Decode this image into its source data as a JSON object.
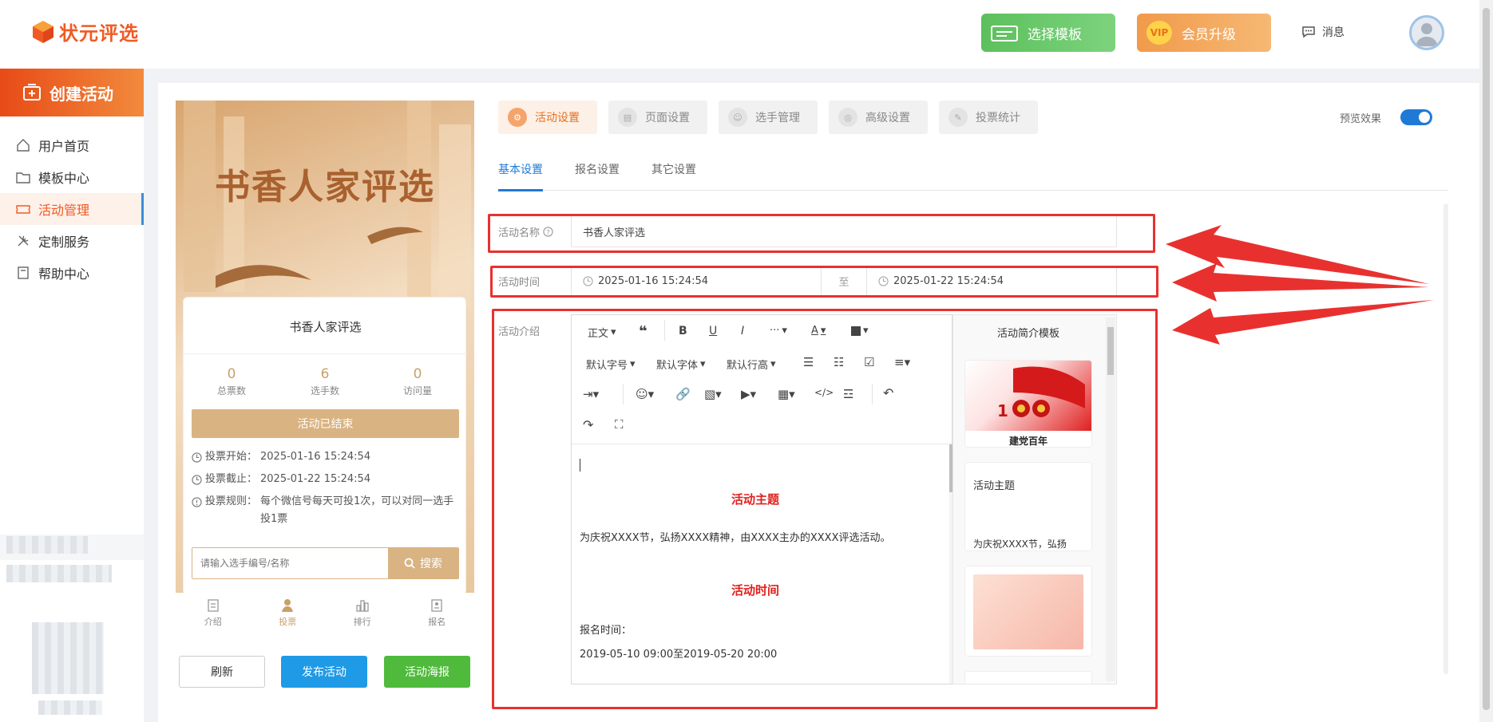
{
  "brand": {
    "name": "状元评选",
    "color": "#f15a24"
  },
  "header": {
    "template_btn": "选择模板",
    "vip_btn": "会员升级",
    "vip_badge": "VIP",
    "messages": "消息"
  },
  "sidebar": {
    "create_btn": "创建活动",
    "items": [
      {
        "label": "用户首页",
        "icon": "home-icon"
      },
      {
        "label": "模板中心",
        "icon": "folder-icon"
      },
      {
        "label": "活动管理",
        "icon": "ticket-icon"
      },
      {
        "label": "定制服务",
        "icon": "tools-icon"
      },
      {
        "label": "帮助中心",
        "icon": "book-icon"
      }
    ]
  },
  "preview": {
    "banner_title": "书香人家评选",
    "card_title": "书香人家评选",
    "stats": [
      {
        "value": "0",
        "label": "总票数"
      },
      {
        "value": "6",
        "label": "选手数"
      },
      {
        "value": "0",
        "label": "访问量"
      }
    ],
    "status": "活动已结束",
    "vote_start_label": "投票开始：",
    "vote_start": "2025-01-16 15:24:54",
    "vote_end_label": "投票截止：",
    "vote_end": "2025-01-22 15:24:54",
    "rule_label": "投票规则：",
    "rule_line1": "每个微信号每天可投1次，可以对同一选手",
    "rule_line2": "投1票",
    "search_placeholder": "请输入选手编号/名称",
    "search_btn": "搜索",
    "tabs": [
      "介绍",
      "投票",
      "排行",
      "报名"
    ]
  },
  "bottom_buttons": {
    "refresh": "刷新",
    "publish": "发布活动",
    "poster": "活动海报"
  },
  "settings_tabs": [
    "活动设置",
    "页面设置",
    "选手管理",
    "高级设置",
    "投票统计"
  ],
  "preview_toggle": {
    "label": "预览效果",
    "on": true
  },
  "sub_tabs": [
    "基本设置",
    "报名设置",
    "其它设置"
  ],
  "form": {
    "name_label": "活动名称",
    "name_value": "书香人家评选",
    "time_label": "活动时间",
    "time_start": "2025-01-16 15:24:54",
    "time_sep": "至",
    "time_end": "2025-01-22 15:24:54",
    "intro_label": "活动介绍"
  },
  "editor": {
    "toolbar": {
      "paragraph": "正文",
      "font_size": "默认字号",
      "font_family": "默认字体",
      "line_height": "默认行高",
      "bold": "B",
      "underline": "U",
      "italic": "I",
      "more": "···",
      "font_color": "A"
    },
    "content": {
      "heading1": "活动主题",
      "para1": "为庆祝XXXX节，弘扬XXXX精神，由XXXX主办的XXXX评选活动。",
      "heading2": "活动时间",
      "para2": "报名时间：",
      "para3": "2019-05-10 09:00至2019-05-20 20:00"
    }
  },
  "template_panel": {
    "title": "活动简介模板",
    "item1": "建党百年",
    "item2_title": "活动主题",
    "item2_text": "为庆祝XXXX节，弘扬"
  },
  "colors": {
    "accent": "#1f7ad6",
    "highlight": "#e8312f",
    "gold": "#d9b382"
  }
}
